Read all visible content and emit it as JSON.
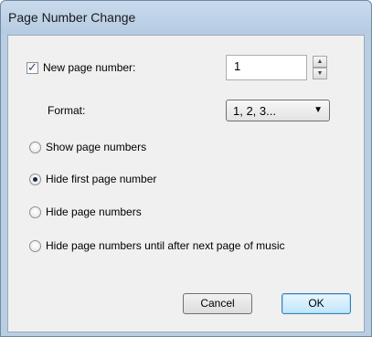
{
  "dialog": {
    "title": "Page Number Change"
  },
  "new_page_number": {
    "label": "New page number:",
    "checked": true,
    "value": "1"
  },
  "format": {
    "label": "Format:",
    "selected": "1, 2, 3..."
  },
  "options": [
    {
      "label": "Show page numbers",
      "selected": false
    },
    {
      "label": "Hide first page number",
      "selected": true
    },
    {
      "label": "Hide page numbers",
      "selected": false
    },
    {
      "label": "Hide page numbers until after next page of music",
      "selected": false
    }
  ],
  "buttons": {
    "cancel": "Cancel",
    "ok": "OK"
  },
  "icons": {
    "spin_up": "spin-up-arrow-icon",
    "spin_down": "spin-down-arrow-icon",
    "dropdown": "dropdown-arrow-icon"
  }
}
